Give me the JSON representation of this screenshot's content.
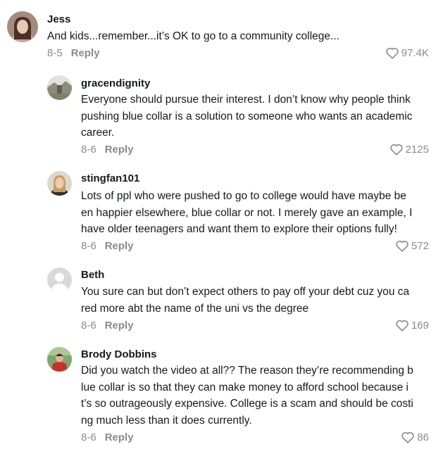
{
  "comments": [
    {
      "username": "Jess",
      "lines": [
        "And kids...remember...it’s OK to go to a community college..."
      ],
      "date": "8-5",
      "reply_label": "Reply",
      "likes": "97.4K",
      "avatar_icon": "user-photo-avatar"
    },
    {
      "username": "gracendignity",
      "lines": [
        "Everyone should pursue their interest. I don’t know why people think",
        "pushing blue collar is a solution to someone who wants an academic",
        "career."
      ],
      "date": "8-6",
      "reply_label": "Reply",
      "likes": "2125",
      "avatar_icon": "landscape-photo-avatar"
    },
    {
      "username": "stingfan101",
      "lines": [
        "Lots of ppl who were pushed to go to college would have maybe be",
        "en happier elsewhere, blue collar or not. I merely gave an example, I",
        "have older teenagers and want them to explore their options fully!"
      ],
      "date": "8-6",
      "reply_label": "Reply",
      "likes": "572",
      "avatar_icon": "user-photo-avatar"
    },
    {
      "username": "Beth",
      "lines": [
        "You sure can but don’t expect others to pay off your debt cuz you ca",
        "red more abt the name of the uni vs the degree"
      ],
      "date": "8-6",
      "reply_label": "Reply",
      "likes": "169",
      "avatar_icon": "default-user-avatar"
    },
    {
      "username": "Brody Dobbins",
      "lines": [
        "Did you watch the video at all?? The reason they’re recommending b",
        "lue collar is so that they can make money to afford school because i",
        "t’s so outrageously expensive. College is a scam and should be costi",
        "ng much less than it does currently."
      ],
      "date": "8-6",
      "reply_label": "Reply",
      "likes": "86",
      "avatar_icon": "user-photo-avatar"
    }
  ],
  "colors": {
    "text": "#161823",
    "meta": "#8a8b91",
    "default_avatar_bg": "#d9d9dc"
  },
  "icons": {
    "like": "heart-outline-icon"
  }
}
